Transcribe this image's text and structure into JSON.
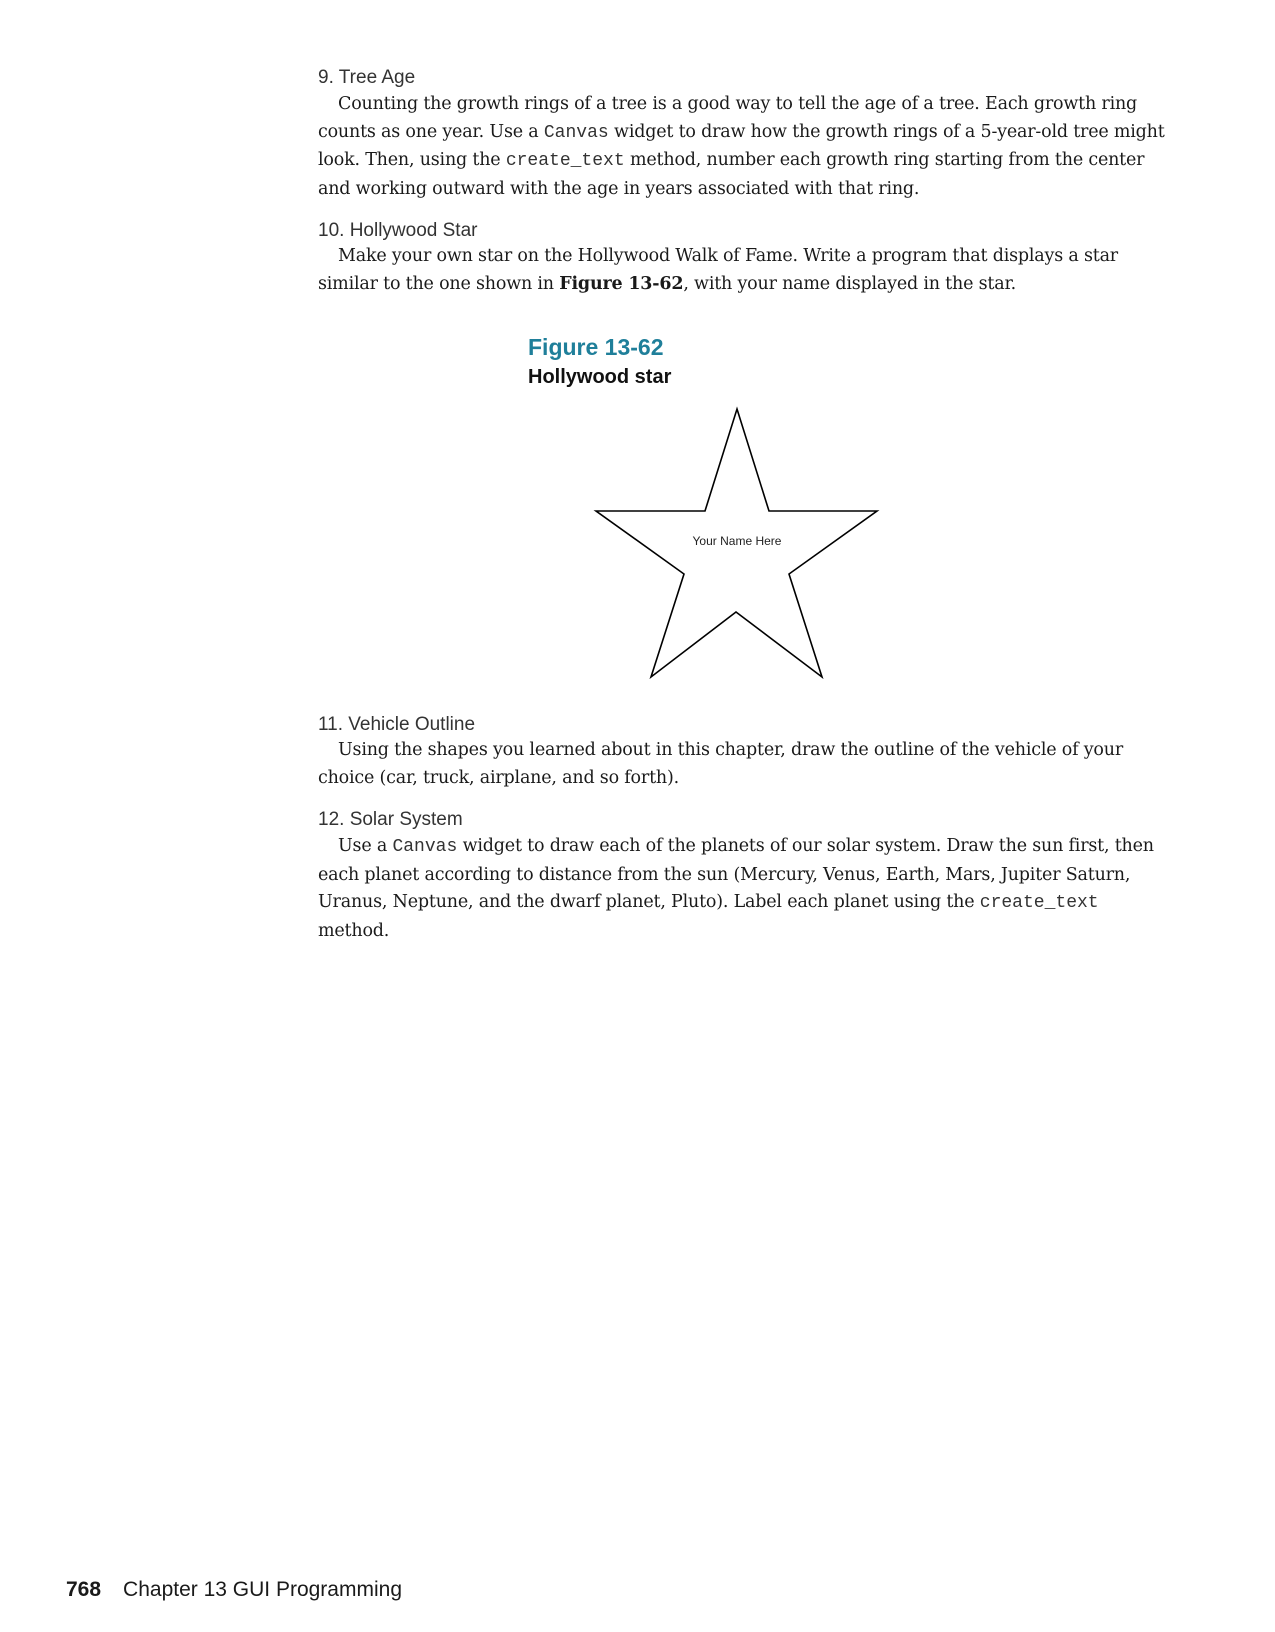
{
  "exercises": [
    {
      "title": "9. Tree Age",
      "p1": "Counting the growth rings of a tree is a good way to tell the age of a tree. Each growth ring counts as one year. Use a ",
      "c1": "Canvas",
      "p2": " widget to draw how the growth rings of a 5-year-old tree might look. Then, using the ",
      "c2": "create_text",
      "p3": " method, number each growth ring starting from the center and working outward with the age in years associated with that ring."
    },
    {
      "title": "10. Hollywood Star",
      "p1": "Make your own star on the Hollywood Walk of Fame. Write a program that displays a star similar to the one shown in ",
      "b1": "Figure 13-62",
      "p2": ", with your name displayed in the star."
    },
    {
      "title": "11. Vehicle Outline",
      "p1": "Using the shapes you learned about in this chapter, draw the outline of the vehicle of your choice (car, truck, airplane, and so forth)."
    },
    {
      "title": "12. Solar System",
      "p1": "Use a ",
      "c1": "Canvas",
      "p2": " widget to draw each of the planets of our solar system. Draw the sun first, then each planet according to distance from the sun (Mercury, Venus, Earth, Mars, Jupiter Saturn, Uranus, Neptune, and the dwarf planet, Pluto). Label each planet using the ",
      "c2": "create_text",
      "p3": " method."
    }
  ],
  "figure": {
    "label": "Figure 13-62",
    "caption": "Hollywood star",
    "star_text": "Your Name Here"
  },
  "footer": {
    "page_number": "768",
    "chapter": "Chapter 13 GUI Programming"
  }
}
